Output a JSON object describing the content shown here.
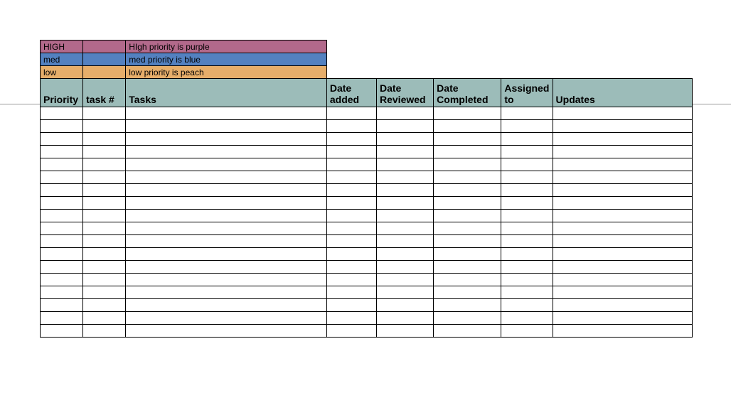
{
  "legend": {
    "high": {
      "label": "HIGH",
      "desc": "HIgh priority is purple"
    },
    "med": {
      "label": "med",
      "desc": "med priority is blue"
    },
    "low": {
      "label": "low",
      "desc": "low priority is peach"
    }
  },
  "headers": {
    "priority": "Priority",
    "task_no": "task #",
    "tasks": "Tasks",
    "date_added": "Date added",
    "date_reviewed": "Date Reviewed",
    "date_completed": "Date Completed",
    "assigned_to": "Assigned to",
    "updates": "Updates"
  },
  "empty_row_count": 18
}
